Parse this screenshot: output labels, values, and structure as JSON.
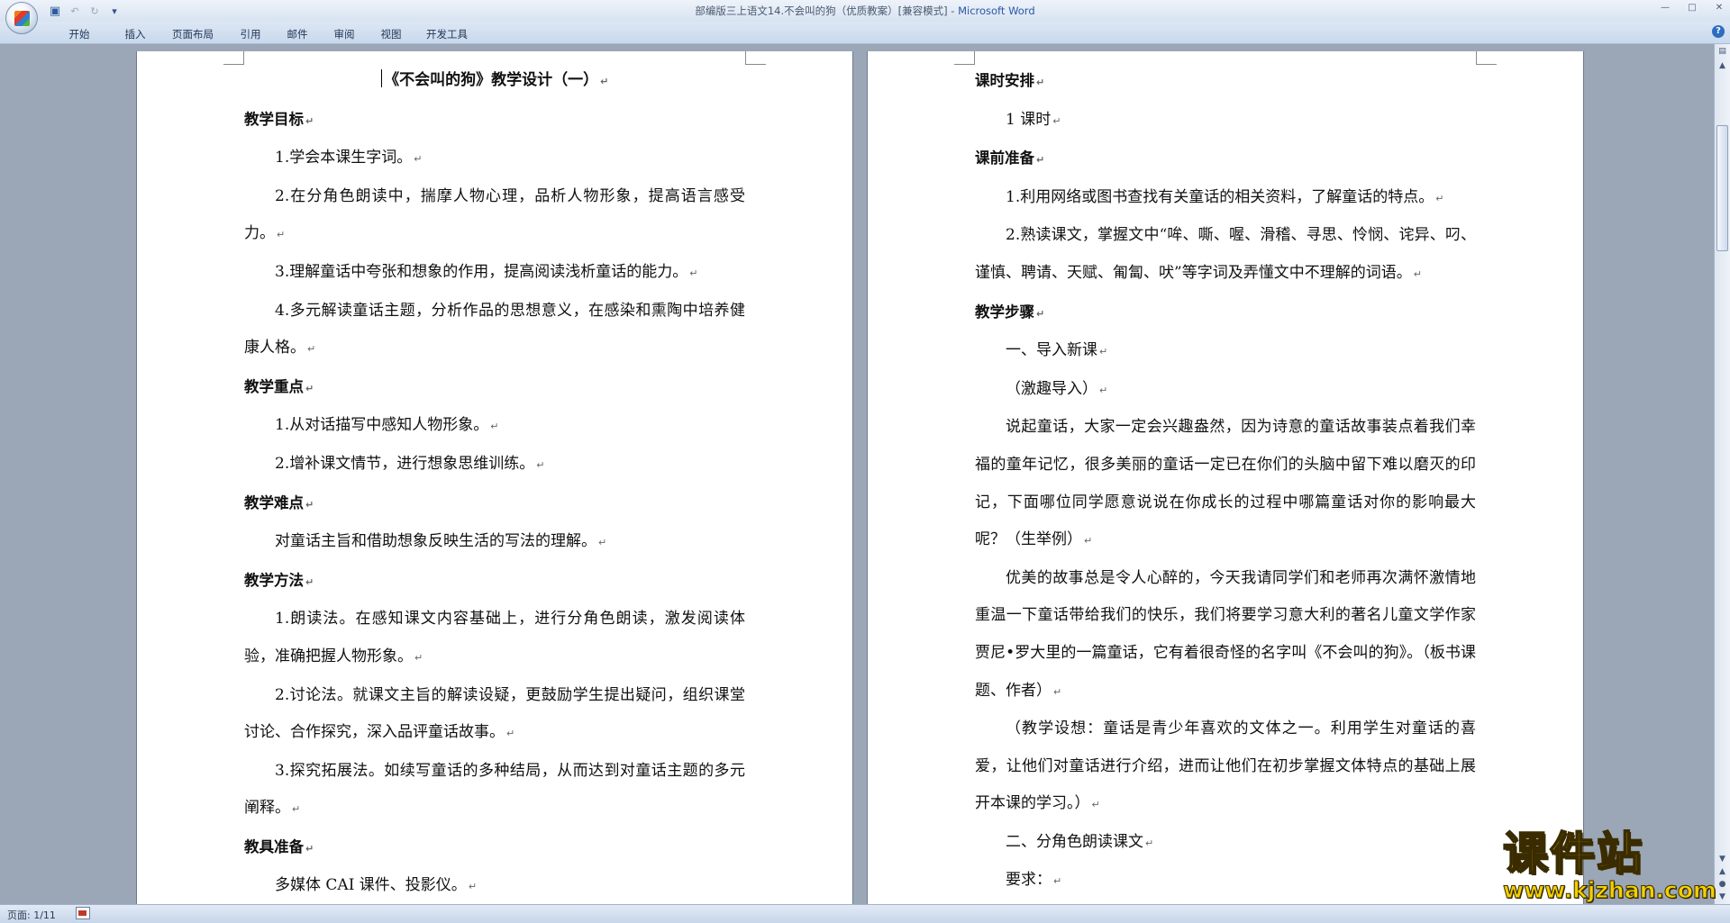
{
  "window": {
    "title": "部编版三上语文14.不会叫的狗（优质教案）[兼容模式] - ",
    "app_name": "Microsoft Word"
  },
  "quick_access": [
    "save-icon",
    "undo-icon",
    "redo-icon",
    "customize-icon"
  ],
  "ribbon": {
    "tabs": [
      {
        "label": "开始",
        "width": 72
      },
      {
        "label": "插入",
        "width": 52
      },
      {
        "label": "页面布局",
        "width": 76
      },
      {
        "label": "引用",
        "width": 52
      },
      {
        "label": "邮件",
        "width": 52
      },
      {
        "label": "审阅",
        "width": 52
      },
      {
        "label": "视图",
        "width": 52
      },
      {
        "label": "开发工具",
        "width": 72
      }
    ]
  },
  "page_left": {
    "paragraphs": [
      {
        "type": "title",
        "text": "《不会叫的狗》教学设计（一）"
      },
      {
        "type": "heading",
        "text": "教学目标"
      },
      {
        "type": "indent",
        "text": "1.学会本课生字词。"
      },
      {
        "type": "wrap",
        "text": "2.在分角色朗读中，揣摩人物心理，品析人物形象，提高语言感受力。"
      },
      {
        "type": "indent",
        "text": "3.理解童话中夸张和想象的作用，提高阅读浅析童话的能力。"
      },
      {
        "type": "wrap",
        "text": "4.多元解读童话主题，分析作品的思想意义，在感染和熏陶中培养健康人格。"
      },
      {
        "type": "heading",
        "text": "教学重点"
      },
      {
        "type": "indent",
        "text": "1.从对话描写中感知人物形象。"
      },
      {
        "type": "indent",
        "text": "2.增补课文情节，进行想象思维训练。"
      },
      {
        "type": "heading",
        "text": "教学难点"
      },
      {
        "type": "indent",
        "text": "对童话主旨和借助想象反映生活的写法的理解。"
      },
      {
        "type": "heading",
        "text": "教学方法"
      },
      {
        "type": "wrap",
        "text": "1.朗读法。在感知课文内容基础上，进行分角色朗读，激发阅读体验，准确把握人物形象。"
      },
      {
        "type": "wrap",
        "text": "2.讨论法。就课文主旨的解读设疑，更鼓励学生提出疑问，组织课堂讨论、合作探究，深入品评童话故事。"
      },
      {
        "type": "wrap",
        "text": "3.探究拓展法。如续写童话的多种结局，从而达到对童话主题的多元阐释。"
      },
      {
        "type": "heading",
        "text": "教具准备"
      },
      {
        "type": "indent",
        "text": "多媒体 CAI 课件、投影仪。"
      }
    ]
  },
  "page_right": {
    "paragraphs": [
      {
        "type": "heading",
        "text": "课时安排"
      },
      {
        "type": "indent",
        "text": "1 课时"
      },
      {
        "type": "heading",
        "text": "课前准备"
      },
      {
        "type": "indent",
        "text": "1.利用网络或图书查找有关童话的相关资料，了解童话的特点。"
      },
      {
        "type": "wrap",
        "text": "2.熟读课文，掌握文中“哞、嘶、喔、滑稽、寻思、怜悯、诧异、叼、谨慎、聘请、天赋、匍匐、吠”等字词及弄懂文中不理解的词语。"
      },
      {
        "type": "heading",
        "text": "教学步骤"
      },
      {
        "type": "indent",
        "text": "一、导入新课"
      },
      {
        "type": "indent",
        "text": "（激趣导入）"
      },
      {
        "type": "wrap",
        "text": "说起童话，大家一定会兴趣盎然，因为诗意的童话故事装点着我们幸福的童年记忆，很多美丽的童话一定已在你们的头脑中留下难以磨灭的印记，下面哪位同学愿意说说在你成长的过程中哪篇童话对你的影响最大呢？（生举例）"
      },
      {
        "type": "wrap",
        "text": "优美的故事总是令人心醉的，今天我请同学们和老师再次满怀激情地重温一下童话带给我们的快乐，我们将要学习意大利的著名儿童文学作家贾尼•罗大里的一篇童话，它有着很奇怪的名字叫《不会叫的狗》。（板书课题、作者）"
      },
      {
        "type": "wrap",
        "text": "（教学设想：童话是青少年喜欢的文体之一。利用学生对童话的喜爱，让他们对童话进行介绍，进而让他们在初步掌握文体特点的基础上展开本课的学习。）"
      },
      {
        "type": "indent",
        "text": "二、分角色朗读课文"
      },
      {
        "type": "indent",
        "text": "要求："
      }
    ]
  },
  "statusbar": {
    "page_info": "页面: 1/11"
  },
  "watermark": {
    "main": "课件站",
    "url": "www.kjzhan.com"
  }
}
